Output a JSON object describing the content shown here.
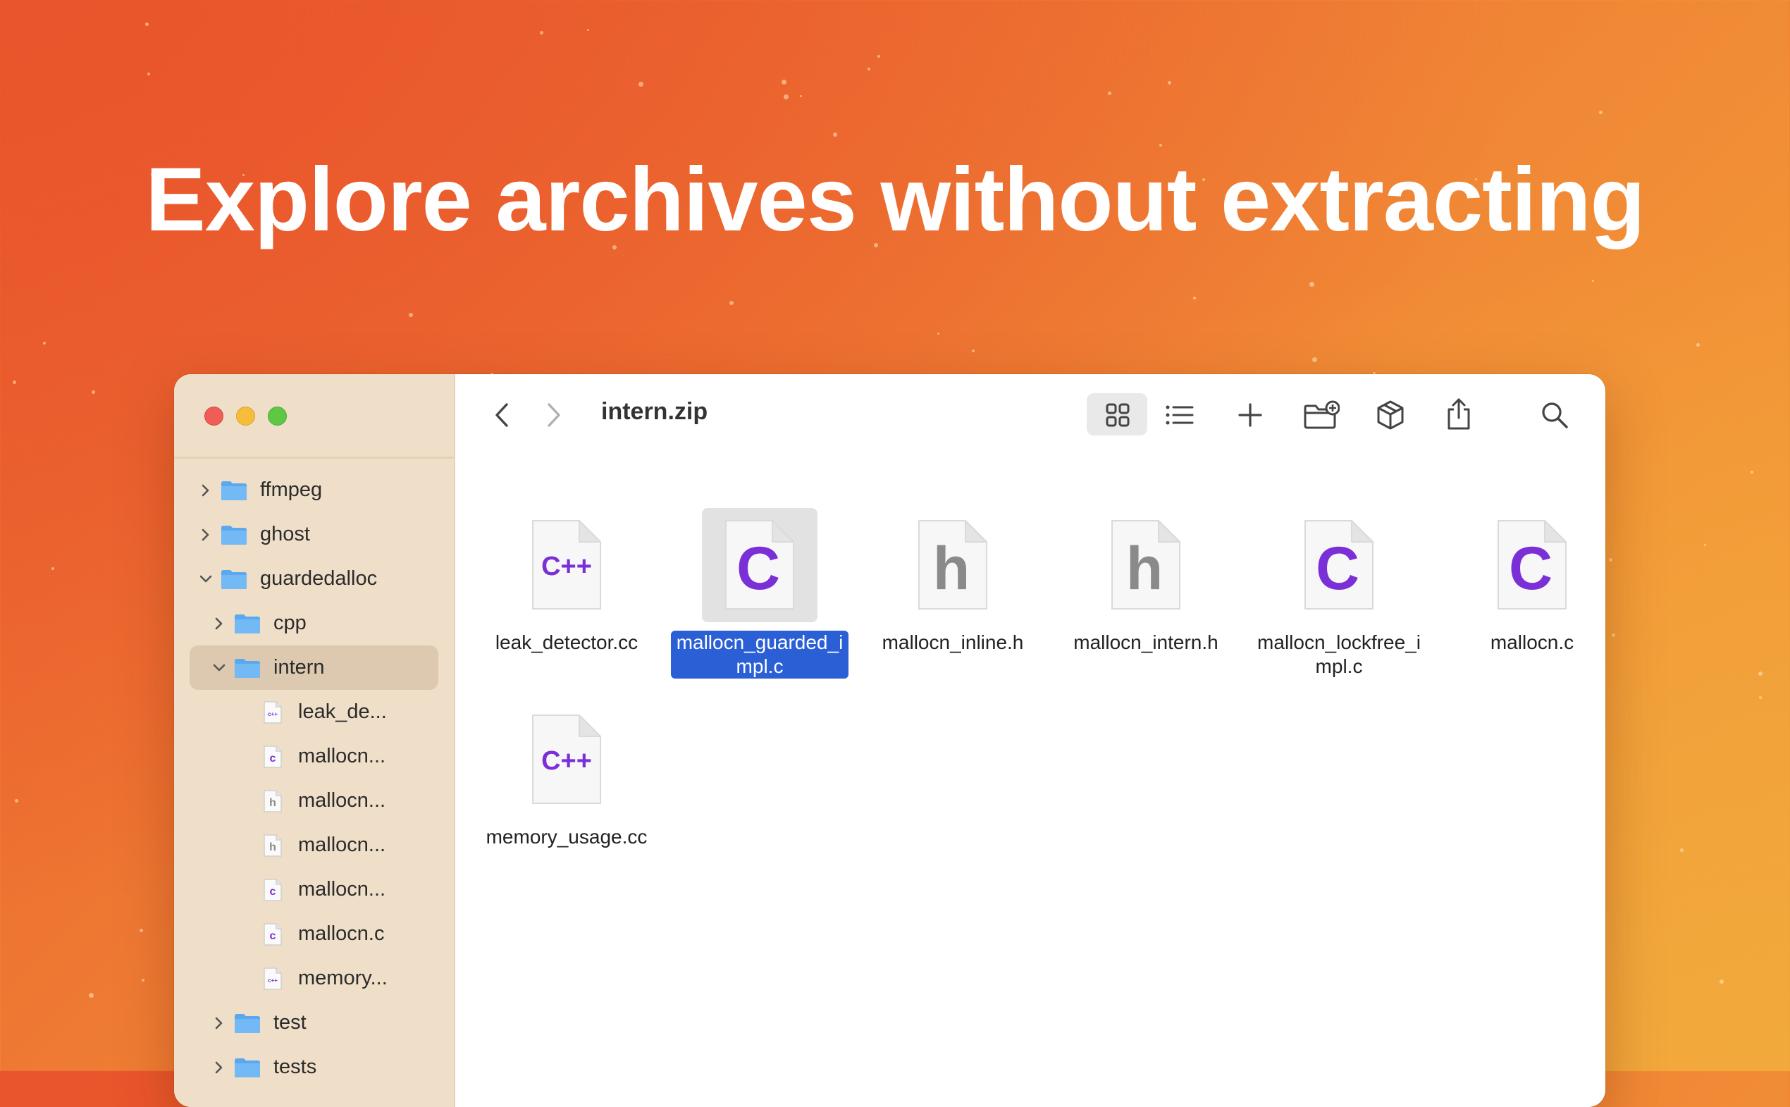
{
  "headline": "Explore archives without extracting",
  "toolbar": {
    "title": "intern.zip",
    "back_icon": "chevron-left-icon",
    "forward_icon": "chevron-right-icon",
    "view_grid_icon": "grid-view-icon",
    "view_list_icon": "list-view-icon",
    "add_icon": "plus-icon",
    "new_folder_icon": "folder-plus-icon",
    "archive_icon": "package-icon",
    "share_icon": "share-icon",
    "search_icon": "search-icon"
  },
  "sidebar": {
    "items": [
      {
        "label": "ffmpeg",
        "type": "folder",
        "depth": 0,
        "expanded": false
      },
      {
        "label": "ghost",
        "type": "folder",
        "depth": 0,
        "expanded": false
      },
      {
        "label": "guardedalloc",
        "type": "folder",
        "depth": 0,
        "expanded": true
      },
      {
        "label": "cpp",
        "type": "folder",
        "depth": 1,
        "expanded": false
      },
      {
        "label": "intern",
        "type": "folder",
        "depth": 1,
        "expanded": true,
        "selected": true
      },
      {
        "label": "leak_de...",
        "type": "cpp",
        "depth": 2
      },
      {
        "label": "mallocn...",
        "type": "c",
        "depth": 2
      },
      {
        "label": "mallocn...",
        "type": "h",
        "depth": 2
      },
      {
        "label": "mallocn...",
        "type": "h",
        "depth": 2
      },
      {
        "label": "mallocn...",
        "type": "c",
        "depth": 2
      },
      {
        "label": "mallocn.c",
        "type": "c",
        "depth": 2
      },
      {
        "label": "memory...",
        "type": "cpp",
        "depth": 2
      },
      {
        "label": "test",
        "type": "folder",
        "depth": 1,
        "expanded": false
      },
      {
        "label": "tests",
        "type": "folder",
        "depth": 1,
        "expanded": false
      }
    ]
  },
  "files": [
    {
      "name": "leak_detector.cc",
      "glyph": "C++",
      "type": "cpp"
    },
    {
      "name": "mallocn_guarded_impl.c",
      "glyph": "C",
      "type": "c",
      "selected": true
    },
    {
      "name": "mallocn_inline.h",
      "glyph": "h",
      "type": "h"
    },
    {
      "name": "mallocn_intern.h",
      "glyph": "h",
      "type": "h"
    },
    {
      "name": "mallocn_lockfree_impl.c",
      "glyph": "C",
      "type": "c"
    },
    {
      "name": "mallocn.c",
      "glyph": "C",
      "type": "c"
    },
    {
      "name": "memory_usage.cc",
      "glyph": "C++",
      "type": "cpp"
    }
  ],
  "colors": {
    "accent_purple": "#7b2fd6",
    "header_gray": "#8a8a8a",
    "selection_blue": "#2a5fd6",
    "folder_blue": "#5aa9ef"
  }
}
